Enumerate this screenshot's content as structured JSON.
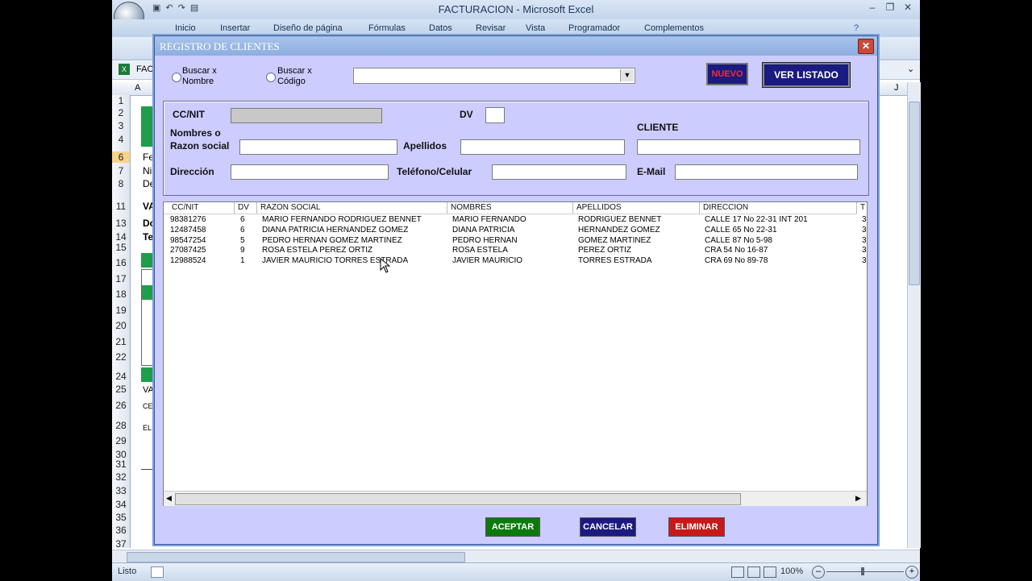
{
  "excel": {
    "window_title": "FACTURACION - Microsoft Excel",
    "ribbon_tabs": [
      "Inicio",
      "Insertar",
      "Diseño de página",
      "Fórmulas",
      "Datos",
      "Revisar",
      "Vista",
      "Programador",
      "Complementos"
    ],
    "doc_name": "FAC",
    "col_a": "A",
    "col_j": "J",
    "row_numbers": [
      "1",
      "2",
      "3",
      "4",
      "6",
      "7",
      "8",
      "11",
      "13",
      "14",
      "15",
      "16",
      "17",
      "18",
      "19",
      "20",
      "21",
      "22",
      "24",
      "25",
      "26",
      "28",
      "29",
      "30",
      "31",
      "32",
      "33",
      "34",
      "35",
      "36",
      "37"
    ],
    "cell_fragments": [
      "Fe",
      "Ni",
      "De",
      "VA",
      "Do",
      "Te",
      "VA",
      "CE",
      "EL"
    ],
    "status_text": "Listo",
    "zoom": "100%"
  },
  "dialog": {
    "title": "REGISTRO DE CLIENTES",
    "close_label": "✕",
    "radio_nombre": [
      "Buscar x",
      "Nombre"
    ],
    "radio_codigo": [
      "Buscar x",
      "Código"
    ],
    "search_value": "",
    "btn_nuevo": "NUEVO",
    "btn_ver_listado": "VER LISTADO",
    "labels": {
      "ccnit": "CC/NIT",
      "dv": "DV",
      "nombres1": "Nombres o",
      "nombres2": "Razon social",
      "apellidos": "Apellidos",
      "cliente": "CLIENTE",
      "direccion": "Dirección",
      "telefono": "Teléfono/Celular",
      "email": "E-Mail"
    },
    "fields": {
      "ccnit": "",
      "dv": "",
      "nombres": "",
      "apellidos": "",
      "cliente": "",
      "direccion": "",
      "telefono": "",
      "email": ""
    },
    "list": {
      "columns": [
        "CC/NIT",
        "DV",
        "RAZON SOCIAL",
        "NOMBRES",
        "APELLIDOS",
        "DIRECCION",
        "T"
      ],
      "rows": [
        [
          "98381276",
          "6",
          "MARIO FERNANDO RODRIGUEZ BENNET",
          "MARIO FERNANDO",
          "RODRIGUEZ BENNET",
          "CALLE 17 No 22-31 INT 201",
          "3"
        ],
        [
          "12487458",
          "6",
          "DIANA PATRICIA HERNANDEZ GOMEZ",
          "DIANA PATRICIA",
          "HERNANDEZ GOMEZ",
          "CALLE 65 No 22-31",
          "3"
        ],
        [
          "98547254",
          "5",
          "PEDRO HERNAN GOMEZ MARTINEZ",
          "PEDRO HERNAN",
          "GOMEZ MARTINEZ",
          "CALLE 87 No 5-98",
          "3"
        ],
        [
          "27087425",
          "9",
          "ROSA ESTELA  PEREZ ORTIZ",
          "ROSA ESTELA",
          "PEREZ ORTIZ",
          "CRA 54 No 16-87",
          "3"
        ],
        [
          "12988524",
          "1",
          "JAVIER MAURICIO  TORRES ESTRADA",
          "JAVIER MAURICIO",
          "TORRES ESTRADA",
          "CRA 69 No 89-78",
          "3"
        ]
      ]
    },
    "btn_aceptar": "ACEPTAR",
    "btn_cancelar": "CANCELAR",
    "btn_eliminar": "ELIMINAR",
    "colors": {
      "aceptar": "#0b7a0b",
      "cancelar": "#1a1a80",
      "eliminar": "#c81818",
      "nuevo": "#1a1a80",
      "nuevo_text": "#ff2222"
    }
  }
}
